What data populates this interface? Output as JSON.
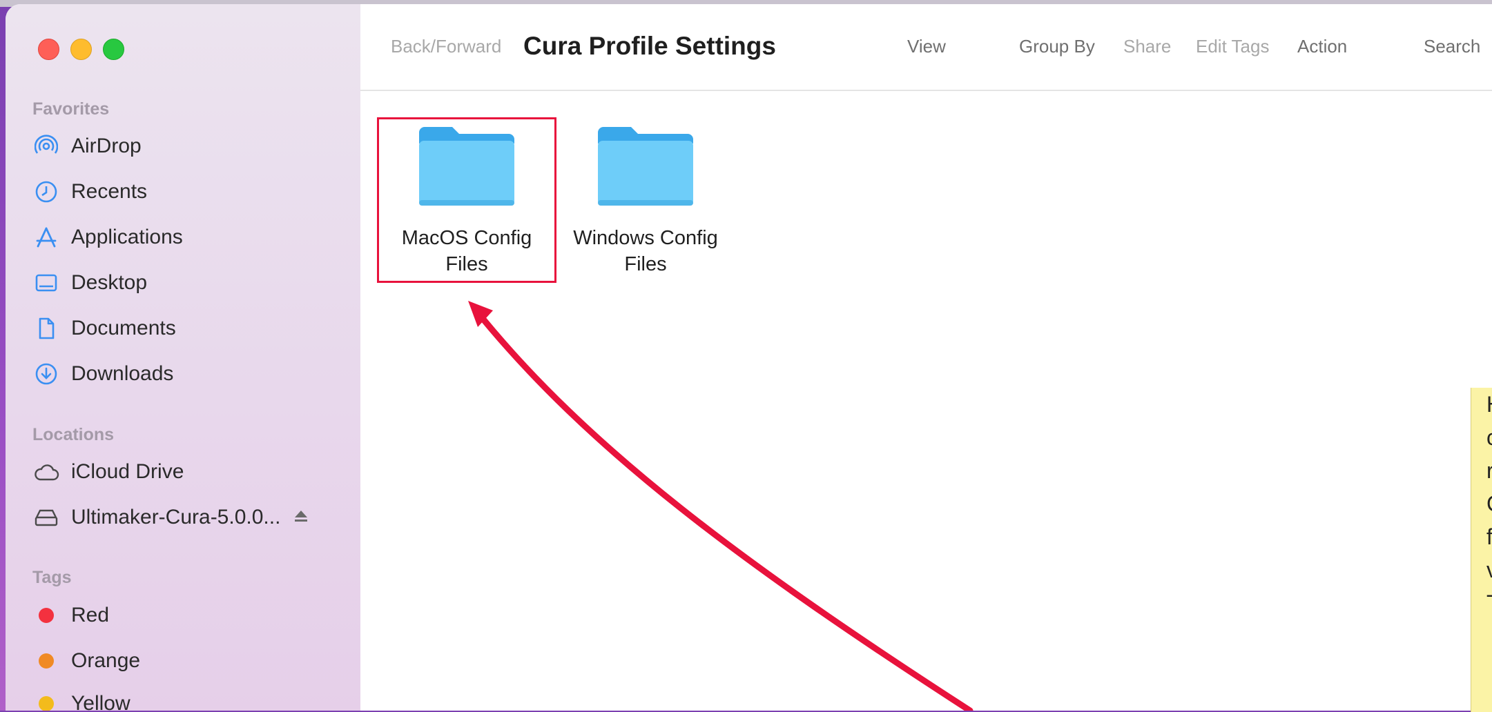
{
  "window": {
    "title": "Cura Profile Settings"
  },
  "toolbar": {
    "back_forward": "Back/Forward",
    "view": "View",
    "group_by": "Group By",
    "share": "Share",
    "edit_tags": "Edit Tags",
    "action": "Action",
    "search": "Search"
  },
  "sidebar": {
    "favorites_title": "Favorites",
    "favorites": [
      {
        "label": "AirDrop",
        "icon": "airdrop-icon"
      },
      {
        "label": "Recents",
        "icon": "clock-icon"
      },
      {
        "label": "Applications",
        "icon": "applications-icon"
      },
      {
        "label": "Desktop",
        "icon": "desktop-icon"
      },
      {
        "label": "Documents",
        "icon": "document-icon"
      },
      {
        "label": "Downloads",
        "icon": "download-icon"
      }
    ],
    "locations_title": "Locations",
    "locations": [
      {
        "label": "iCloud Drive",
        "icon": "cloud-icon"
      },
      {
        "label": "Ultimaker-Cura-5.0.0...",
        "icon": "disk-icon"
      }
    ],
    "tags_title": "Tags",
    "tags": [
      {
        "label": "Red",
        "color": "#f3313f"
      },
      {
        "label": "Orange",
        "color": "#f08a24"
      },
      {
        "label": "Yellow",
        "color": "#f3bb1c"
      }
    ]
  },
  "folders": [
    {
      "label": "MacOS Config Files",
      "highlighted": true
    },
    {
      "label": "Windows Config Files",
      "highlighted": false
    }
  ],
  "note": {
    "lines": [
      "H",
      "c",
      "r",
      "",
      "C",
      "f",
      "v",
      "",
      "T"
    ]
  },
  "colors": {
    "accent_annotation": "#e8123c",
    "folder_blue": "#5ac8fa"
  }
}
